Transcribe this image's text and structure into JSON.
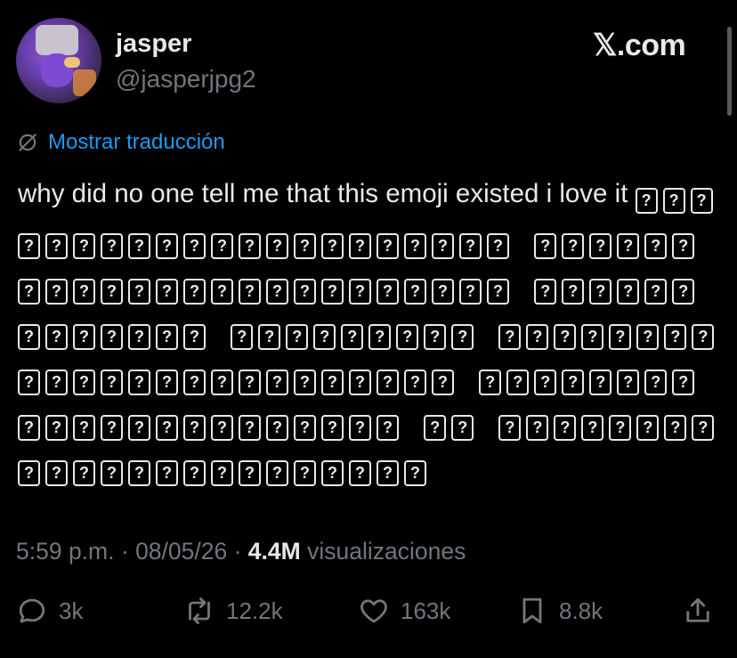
{
  "header": {
    "display_name": "jasper",
    "handle": "@jasperjpg2",
    "brand": "𝕏.com"
  },
  "translate": {
    "label": "Mostrar traducción",
    "color": "#1d9bf0"
  },
  "tweet": {
    "text": "why did no one tell me that this emoji existed i love it",
    "emoji_glyph": "?",
    "emoji_groups": [
      21,
      24,
      13,
      9,
      24,
      22,
      2,
      23
    ]
  },
  "meta": {
    "time": "5:59 p.m.",
    "date": "08/05/26",
    "separator": "·",
    "views_count": "4.4M",
    "views_label": "visualizaciones"
  },
  "actions": {
    "replies": "3k",
    "reposts": "12.2k",
    "likes": "163k",
    "bookmarks": "8.8k"
  },
  "icons": {
    "translate": "translate-icon",
    "reply": "reply-icon",
    "repost": "repost-icon",
    "like": "heart-icon",
    "bookmark": "bookmark-icon",
    "share": "share-icon"
  }
}
